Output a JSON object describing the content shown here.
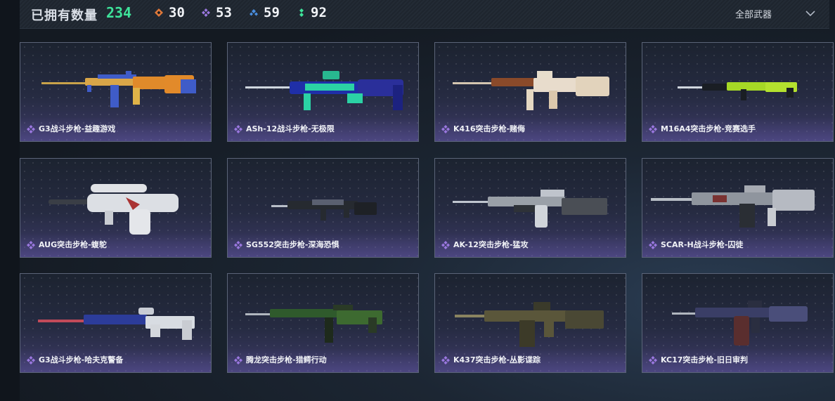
{
  "header": {
    "owned_label": "已拥有数量",
    "owned_count": "234",
    "stats": [
      {
        "icon": "orange-rarity-icon",
        "color": "#e0793a",
        "count": "30"
      },
      {
        "icon": "purple-rarity-icon",
        "color": "#9b78e0",
        "count": "53"
      },
      {
        "icon": "blue-rarity-icon",
        "color": "#4a8fe0",
        "count": "59"
      },
      {
        "icon": "green-rarity-icon",
        "color": "#3ee39a",
        "count": "92"
      }
    ],
    "filter_label": "全部武器"
  },
  "accent": {
    "count_green": "#3ee39a",
    "rarity_purple": "#9b78e0"
  },
  "weapons": [
    {
      "name": "G3战斗步枪-益趣游戏"
    },
    {
      "name": "ASh-12战斗步枪-无极限"
    },
    {
      "name": "K416突击步枪-赌侮"
    },
    {
      "name": "M16A4突击步枪-竞赛选手"
    },
    {
      "name": "AUG突击步枪-蝮鸵"
    },
    {
      "name": "SG552突击步枪-深海恐惧"
    },
    {
      "name": "AK-12突击步枪-猛攻"
    },
    {
      "name": "SCAR-H战斗步枪-囚徒"
    },
    {
      "name": "G3战斗步枪-哈夫克警备"
    },
    {
      "name": "腾龙突击步枪-猎鳄行动"
    },
    {
      "name": "K437突击步枪-丛影谍踪"
    },
    {
      "name": "KC17突击步枪-旧日审判"
    }
  ]
}
